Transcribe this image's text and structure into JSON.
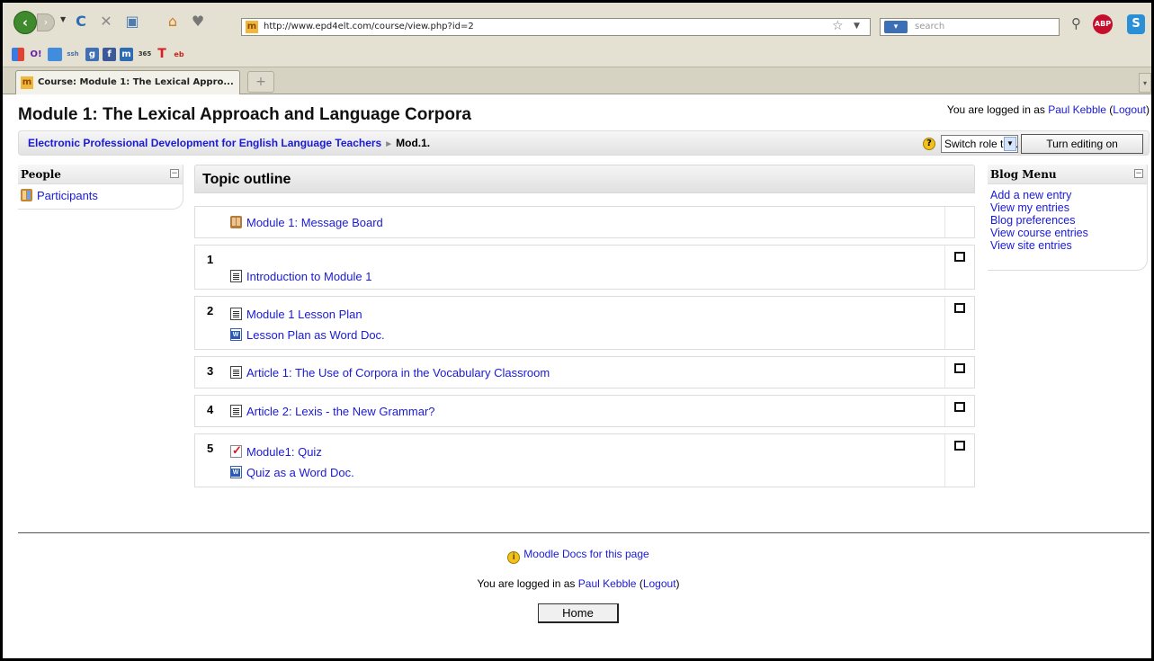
{
  "browser": {
    "url": "http://www.epd4elt.com/course/view.php?id=2",
    "search_placeholder": "search",
    "tab_title": "Course: Module 1: The Lexical Appro...",
    "new_tab": "+",
    "abp_label": "ABP",
    "icons": [
      "back-icon",
      "forward-icon",
      "reload-icon",
      "stop-icon",
      "screenshot-icon",
      "home-icon",
      "bookmark-icon",
      "star-icon",
      "magnifier-icon",
      "adblock-icon",
      "skype-icon"
    ]
  },
  "bookmarks": [
    "google-icon",
    "yahoo-icon",
    "map-icon",
    "ssh-icon",
    "g-icon",
    "facebook-icon",
    "m-icon",
    "365-icon",
    "t-icon",
    "ebay-icon"
  ],
  "bookmark_labels": {
    "y": "O!",
    "ssh": "ssh",
    "g": "g",
    "f": "f",
    "m": "m",
    "n365": "365",
    "t": "T",
    "ebay": "eb"
  },
  "page": {
    "title": "Module 1: The Lexical Approach and Language Corpora",
    "login_prefix": "You are logged in as ",
    "user_name": "Paul Kebble",
    "open_paren": " (",
    "logout": "Logout",
    "close_paren": ")"
  },
  "navbar": {
    "course_link": "Electronic Professional Development for English Language Teachers",
    "separator": "►",
    "current": "Mod.1.",
    "switch_role": "Switch role to...",
    "edit_button": "Turn editing on"
  },
  "people_block": {
    "title": "People",
    "items": [
      {
        "label": "Participants",
        "icon": "participants-icon"
      }
    ]
  },
  "topics": {
    "title": "Topic outline",
    "forum": "Module 1: Message Board",
    "sections": [
      {
        "number": "1",
        "items": [
          "Introduction to Module 1"
        ]
      },
      {
        "number": "2",
        "items": [
          "Module 1 Lesson Plan",
          "Lesson Plan as Word Doc."
        ]
      },
      {
        "number": "3",
        "items": [
          "Article 1: The Use of Corpora in the Vocabulary Classroom"
        ]
      },
      {
        "number": "4",
        "items": [
          "Article 2: Lexis - the New Grammar?"
        ]
      },
      {
        "number": "5",
        "items": [
          "Module1: Quiz",
          "Quiz as a Word Doc."
        ]
      }
    ]
  },
  "blog_block": {
    "title": "Blog Menu",
    "items": [
      "Add a new entry",
      "View my entries",
      "Blog preferences",
      "View course entries",
      "View site entries"
    ]
  },
  "footer": {
    "docs_link": "Moodle Docs for this page",
    "home_button": "Home"
  }
}
